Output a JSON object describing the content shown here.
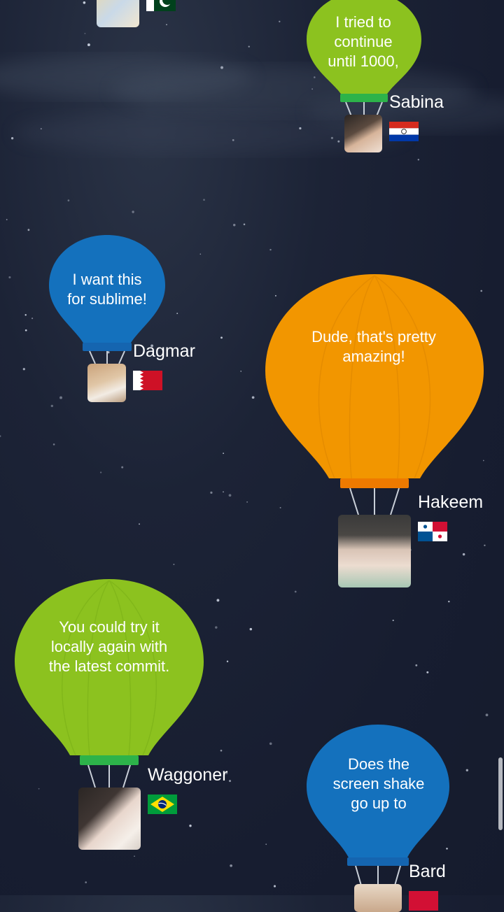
{
  "messages": [
    {
      "text": "",
      "user": "",
      "color": "green",
      "flag": "pakistan"
    },
    {
      "text": "I tried to\ncontinue\nuntil 1000,",
      "user": "Sabina",
      "color": "green",
      "flag": "paraguay"
    },
    {
      "text": "I want this\nfor sublime!",
      "user": "Dagmar",
      "color": "blue",
      "flag": "bahrain"
    },
    {
      "text": "Dude, that's pretty\namazing!",
      "user": "Hakeem",
      "color": "orange",
      "flag": "panama"
    },
    {
      "text": "You could try it\nlocally again with\nthe latest commit.",
      "user": "Waggoner",
      "color": "green",
      "flag": "brazil"
    },
    {
      "text": "Does the\nscreen shake\ngo up to",
      "user": "Bard",
      "color": "blue",
      "flag": "red-flag"
    }
  ],
  "colors": {
    "green": "#8cc21f",
    "green_band": "#2db34a",
    "blue": "#1471bd",
    "blue_band": "#1565b0",
    "orange": "#f29600",
    "orange_band": "#ee7a00",
    "background": "#1a2033"
  },
  "icons": [
    "balloon-icon",
    "avatar-photo",
    "country-flag"
  ]
}
